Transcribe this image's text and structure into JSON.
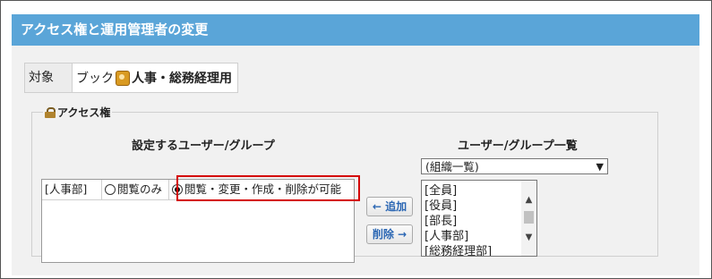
{
  "title": "アクセス権と運用管理者の変更",
  "target": {
    "label": "対象",
    "app": "ブック",
    "book_name": "人事・総務経理用",
    "book_icon": "book-icon"
  },
  "access": {
    "legend": "アクセス権",
    "legend_icon": "lock-icon",
    "left_header": "設定するユーザー/グループ",
    "right_header": "ユーザー/グループ一覧",
    "row": {
      "group": "[人事部]",
      "option_view": "閲覧のみ",
      "option_full": "閲覧・変更・作成・削除が可能",
      "selected": "option_full"
    },
    "add_button": "← 追加",
    "remove_button": "削除 →",
    "select_value": "(組織一覧)",
    "list_items": [
      "[全員]",
      "[役員]",
      "[部長]",
      "[人事部]",
      "[総務経理部]"
    ]
  },
  "colors": {
    "title_bar": "#5aa5d8",
    "highlight": "#d40000",
    "button_text": "#2a66b3"
  }
}
